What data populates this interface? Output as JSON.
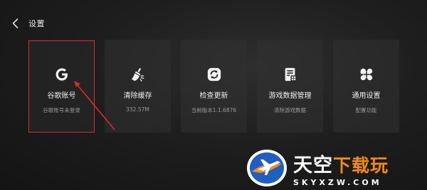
{
  "header": {
    "title": "设置"
  },
  "cards": [
    {
      "label": "谷歌账号",
      "sub": "谷歌账号未登录",
      "icon": "google-g-icon"
    },
    {
      "label": "清除缓存",
      "sub": "332.57M",
      "icon": "broom-icon"
    },
    {
      "label": "检查更新",
      "sub": "当前版本1.1.6876",
      "icon": "refresh-icon"
    },
    {
      "label": "游戏数据管理",
      "sub": "清除游戏数据",
      "icon": "document-grid-icon"
    },
    {
      "label": "通用设置",
      "sub": "配置功能",
      "icon": "four-petal-icon"
    }
  ],
  "annotation": {
    "highlight_color": "#d92b2b"
  },
  "watermark": {
    "brand_main": "天空",
    "brand_accent": "下载玩",
    "url": "SKYXZW.COM"
  },
  "colors": {
    "background": "#1e1e1e",
    "card": "#323232",
    "text": "#ededed",
    "subtext": "#9a9a9a",
    "watermark_accent": "#f08a1c",
    "watermark_blue": "#1e5fbf"
  }
}
